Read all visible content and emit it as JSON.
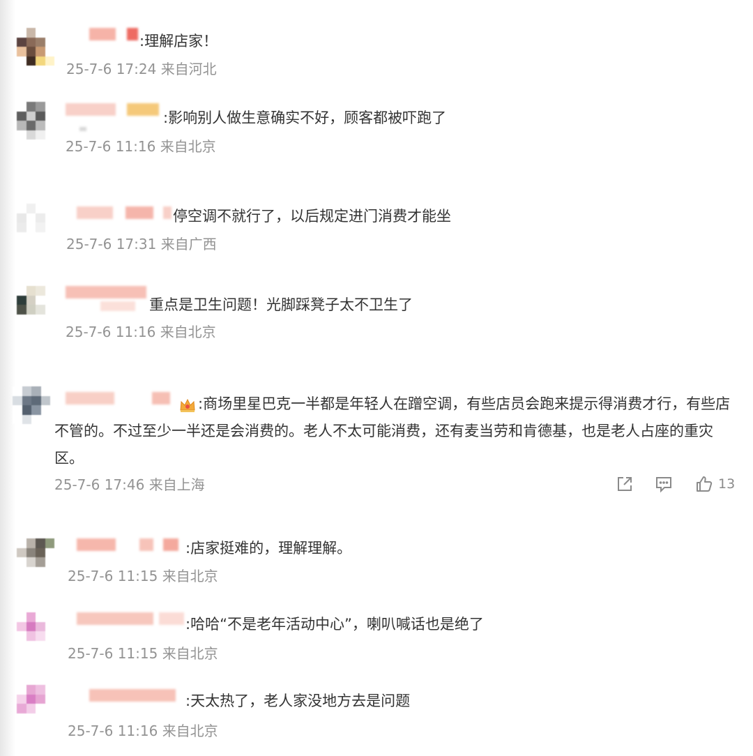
{
  "comments": [
    {
      "prefix": ":",
      "text": "理解店家！",
      "time": "25-7-6 17:24",
      "location": "来自河北"
    },
    {
      "prefix": ":",
      "text": "影响别人做生意确实不好，顾客都被吓跑了",
      "time": "25-7-6 11:16",
      "location": "来自北京"
    },
    {
      "prefix": "",
      "text": "停空调不就行了，以后规定进门消费才能坐",
      "time": "25-7-6 17:31",
      "location": "来自广西"
    },
    {
      "prefix": "",
      "text": "重点是卫生问题！光脚踩凳子太不卫生了",
      "time": "25-7-6 11:16",
      "location": "来自北京"
    },
    {
      "prefix": ":",
      "text": "商场里星巴克一半都是年轻人在蹭空调，有些店员会跑来提示得消费才行，有些店不管的。不过至少一半还是会消费的。老人不太可能消费，还有麦当劳和肯德基，也是老人占座的重灾区。",
      "time": "25-7-6 17:46",
      "location": "来自上海",
      "like_count": "13"
    },
    {
      "prefix": ":",
      "text": "店家挺难的，理解理解。",
      "time": "25-7-6 11:15",
      "location": "来自北京"
    },
    {
      "prefix": ":",
      "text": "哈哈“不是老年活动中心”，喇叭喊话也是绝了",
      "time": "25-7-6 11:15",
      "location": "来自北京"
    },
    {
      "prefix": ":",
      "text": "天太热了，老人家没地方去是问题",
      "time": "25-7-6 11:16",
      "location": "来自北京"
    }
  ],
  "icons": {
    "share": "share-icon",
    "comment": "comment-icon",
    "like": "thumbs-up-icon",
    "badge": "crown-badge-icon"
  },
  "colors": {
    "text": "#333333",
    "meta": "#939393",
    "icon": "#8a8a8a"
  }
}
